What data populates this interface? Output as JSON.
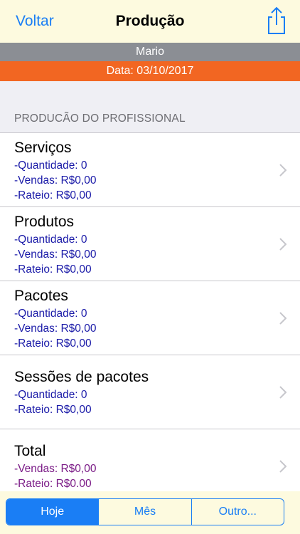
{
  "navbar": {
    "back_label": "Voltar",
    "title": "Produção",
    "share_icon": "share-icon"
  },
  "professional_name": "Mario",
  "date_label": "Data: 03/10/2017",
  "section_header": "PRODUCÃO DO PROFISSIONAL",
  "rows": [
    {
      "title": "Serviços",
      "lines": [
        "-Quantidade: 0",
        "-Vendas: R$0,00",
        "-Rateio: R$0,00"
      ]
    },
    {
      "title": "Produtos",
      "lines": [
        "-Quantidade: 0",
        "-Vendas: R$0,00",
        "-Rateio: R$0,00"
      ]
    },
    {
      "title": "Pacotes",
      "lines": [
        "-Quantidade: 0",
        "-Vendas: R$0,00",
        "-Rateio: R$0,00"
      ]
    },
    {
      "title": "Sessões de pacotes",
      "lines": [
        "-Quantidade: 0",
        "-Rateio: R$0,00"
      ]
    },
    {
      "title": "Total",
      "lines": [
        "-Vendas: R$0,00",
        "-Rateio: R$0.00"
      ]
    }
  ],
  "period_selector": {
    "options": [
      "Hoje",
      "Mês",
      "Outro..."
    ],
    "selected": "Hoje"
  },
  "colors": {
    "accent": "#1a7ef5",
    "name_bar": "#8b8e94",
    "date_bar": "#f26622",
    "detail_text": "#1a1aa8",
    "total_text": "#7a1a86",
    "bar_background": "#fdfadf"
  }
}
